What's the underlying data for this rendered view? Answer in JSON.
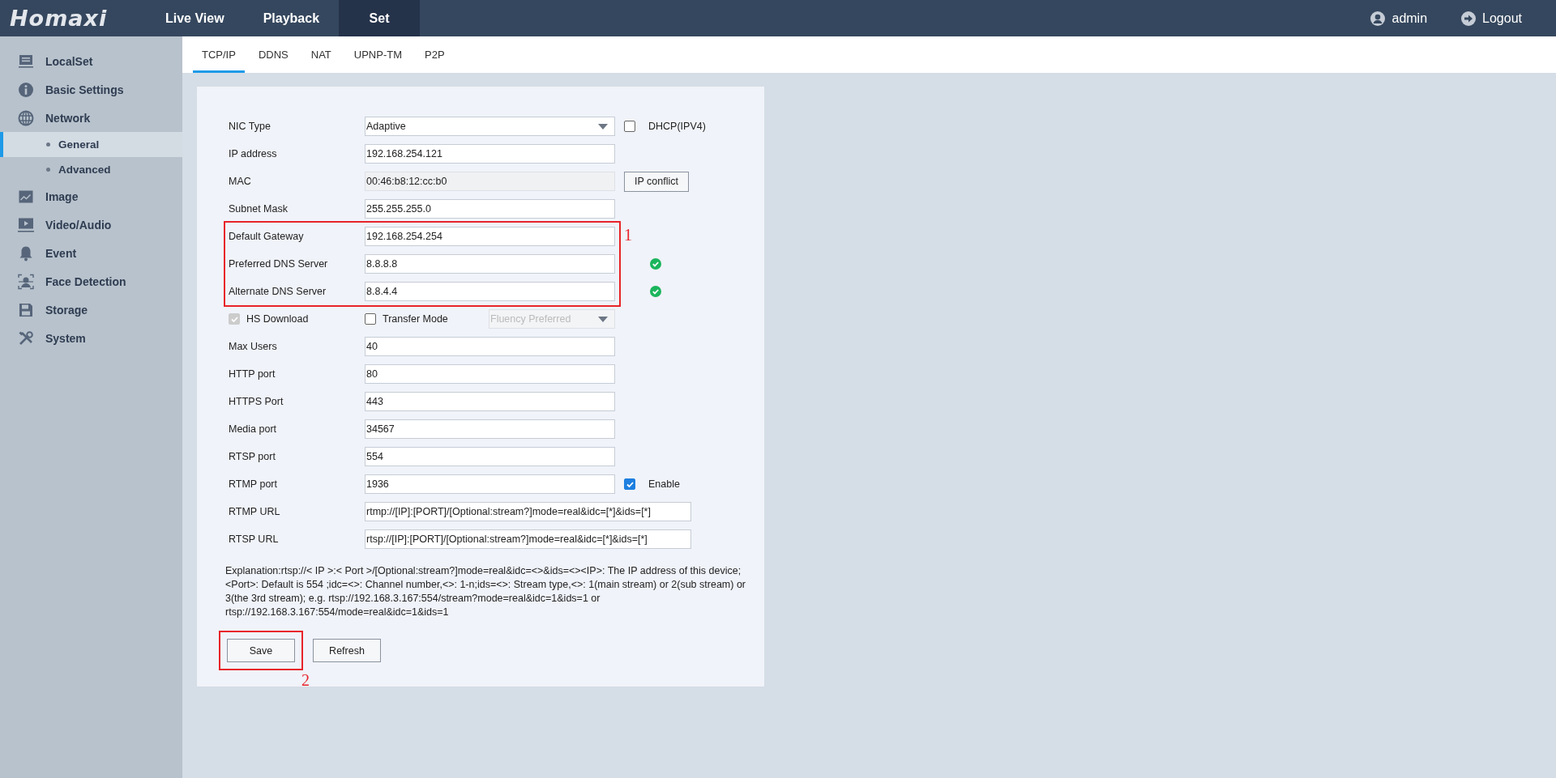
{
  "header": {
    "logo": "Homaxi",
    "nav": [
      {
        "label": "Live View",
        "selected": false
      },
      {
        "label": "Playback",
        "selected": false
      },
      {
        "label": "Set",
        "selected": true
      }
    ],
    "user": "admin",
    "logout": "Logout"
  },
  "sidebar": {
    "items": [
      {
        "label": "LocalSet",
        "selected": false
      },
      {
        "label": "Basic Settings",
        "selected": false
      },
      {
        "label": "Network",
        "selected": false,
        "children": [
          {
            "label": "General",
            "selected": true
          },
          {
            "label": "Advanced",
            "selected": false
          }
        ]
      },
      {
        "label": "Image",
        "selected": false
      },
      {
        "label": "Video/Audio",
        "selected": false
      },
      {
        "label": "Event",
        "selected": false
      },
      {
        "label": "Face Detection",
        "selected": false
      },
      {
        "label": "Storage",
        "selected": false
      },
      {
        "label": "System",
        "selected": false
      }
    ]
  },
  "tabs": [
    {
      "label": "TCP/IP",
      "selected": true
    },
    {
      "label": "DDNS",
      "selected": false
    },
    {
      "label": "NAT",
      "selected": false
    },
    {
      "label": "UPNP-TM",
      "selected": false
    },
    {
      "label": "P2P",
      "selected": false
    }
  ],
  "form": {
    "sections": [
      {
        "rows": [
          {
            "kind": "select",
            "label": "NIC Type",
            "value": "Adaptive",
            "checkbox": {
              "label": "DHCP(IPV4)",
              "checked": false
            }
          },
          {
            "kind": "text",
            "label": "IP address",
            "value": "192.168.254.121"
          },
          {
            "kind": "readonly",
            "label": "MAC",
            "value": "00:46:b8:12:cc:b0",
            "button": "IP conflict"
          },
          {
            "kind": "text",
            "label": "Subnet Mask",
            "value": "255.255.255.0"
          }
        ]
      },
      {
        "annotation": "1",
        "rows": [
          {
            "kind": "text",
            "label": "Default Gateway",
            "value": "192.168.254.254",
            "valid": false
          },
          {
            "kind": "text",
            "label": "Preferred DNS Server",
            "value": "8.8.8.8",
            "valid": true
          },
          {
            "kind": "text",
            "label": "Alternate DNS Server",
            "value": "8.8.4.4",
            "valid": true
          }
        ]
      },
      {
        "rows": [
          {
            "kind": "options",
            "checkbox": {
              "label": "HS Download",
              "checked": true,
              "disabled": true
            },
            "mode_checkbox": {
              "label": "Transfer Mode",
              "checked": false,
              "disabled": false
            },
            "select": {
              "value": "Fluency Preferred",
              "disabled": true
            }
          },
          {
            "kind": "text",
            "label": "Max Users",
            "value": "40"
          },
          {
            "kind": "text",
            "label": "HTTP port",
            "value": "80"
          },
          {
            "kind": "text",
            "label": "HTTPS Port",
            "value": "443"
          },
          {
            "kind": "text",
            "label": "Media port",
            "value": "34567"
          },
          {
            "kind": "text",
            "label": "RTSP port",
            "value": "554"
          },
          {
            "kind": "text",
            "label": "RTMP port",
            "value": "1936",
            "checkbox": {
              "label": "Enable",
              "checked": true
            }
          },
          {
            "kind": "url",
            "label": "RTMP URL",
            "value": "rtmp://[IP]:[PORT]/[Optional:stream?]mode=real&idc=[*]&ids=[*]"
          },
          {
            "kind": "url",
            "label": "RTSP URL",
            "value": "rtsp://[IP]:[PORT]/[Optional:stream?]mode=real&idc=[*]&ids=[*]"
          }
        ]
      }
    ],
    "explanation": "Explanation:rtsp://< IP >:< Port >/[Optional:stream?]mode=real&idc=<>&ids=<><IP>: The IP address of this device;<Port>: Default is 554 ;idc=<>: Channel number,<>: 1-n;ids=<>: Stream type,<>: 1(main stream) or 2(sub stream) or 3(the 3rd stream); e.g. rtsp://192.168.3.167:554/stream?mode=real&idc=1&ids=1 or rtsp://192.168.3.167:554/mode=real&idc=1&ids=1",
    "buttons": [
      {
        "label": "Save",
        "annotation": "2"
      },
      {
        "label": "Refresh"
      }
    ]
  }
}
